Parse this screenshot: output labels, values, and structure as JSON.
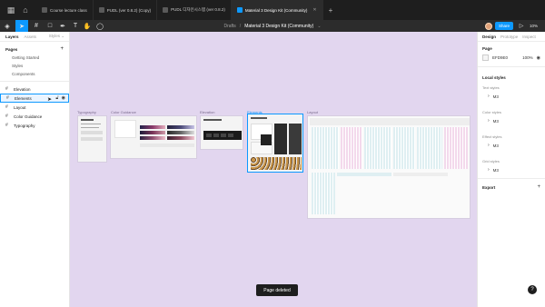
{
  "tabs": [
    {
      "label": "Course lecture class",
      "active": false
    },
    {
      "label": "PUDL (ver 0.8.2) (Copy)",
      "active": false
    },
    {
      "label": "PUDL 디자인시스템 (ver 0.8.2)",
      "active": false
    },
    {
      "label": "Material 3 Design Kit (Community)",
      "active": true
    }
  ],
  "toolbar": {
    "breadcrumb_drafts": "Drafts",
    "breadcrumb_sep": "/",
    "file_title": "Material 3 Design Kit (Community)",
    "share_label": "Share",
    "zoom_label": "10%"
  },
  "left_panel": {
    "tabs": [
      "Layers",
      "Assets"
    ],
    "assets_selector": "Styles",
    "pages_heading": "Pages",
    "pages": [
      "Getting Started",
      "Styles",
      "Components"
    ],
    "layers": [
      {
        "label": "Elevation",
        "hover": false
      },
      {
        "label": "Elements",
        "hover": true
      },
      {
        "label": "Layout",
        "hover": false
      },
      {
        "label": "Color Guidance",
        "hover": false
      },
      {
        "label": "Typography",
        "hover": false
      }
    ]
  },
  "canvas": {
    "background": "#e2d6ef",
    "frames": [
      {
        "label": "Typography",
        "selected": false
      },
      {
        "label": "Color Guidance",
        "selected": false
      },
      {
        "label": "Elevation",
        "selected": false
      },
      {
        "label": "Elements",
        "selected": true
      },
      {
        "label": "Layout",
        "selected": false
      }
    ],
    "toast": "Page deleted"
  },
  "right_panel": {
    "tabs": [
      "Design",
      "Prototype",
      "Inspect"
    ],
    "page_heading": "Page",
    "page_color": "EFD9E0",
    "page_opacity": "100%",
    "local_styles_heading": "Local styles",
    "groups": [
      {
        "title": "Text styles",
        "item": "M3"
      },
      {
        "title": "Color styles",
        "item": "M3"
      },
      {
        "title": "Effect styles",
        "item": "M3"
      },
      {
        "title": "Grid styles",
        "item": "M3"
      }
    ],
    "export_heading": "Export"
  },
  "colors": {
    "accent": "#0d99ff",
    "chrome_dark": "#2c2c2c",
    "tabstrip": "#1e1e1e"
  }
}
